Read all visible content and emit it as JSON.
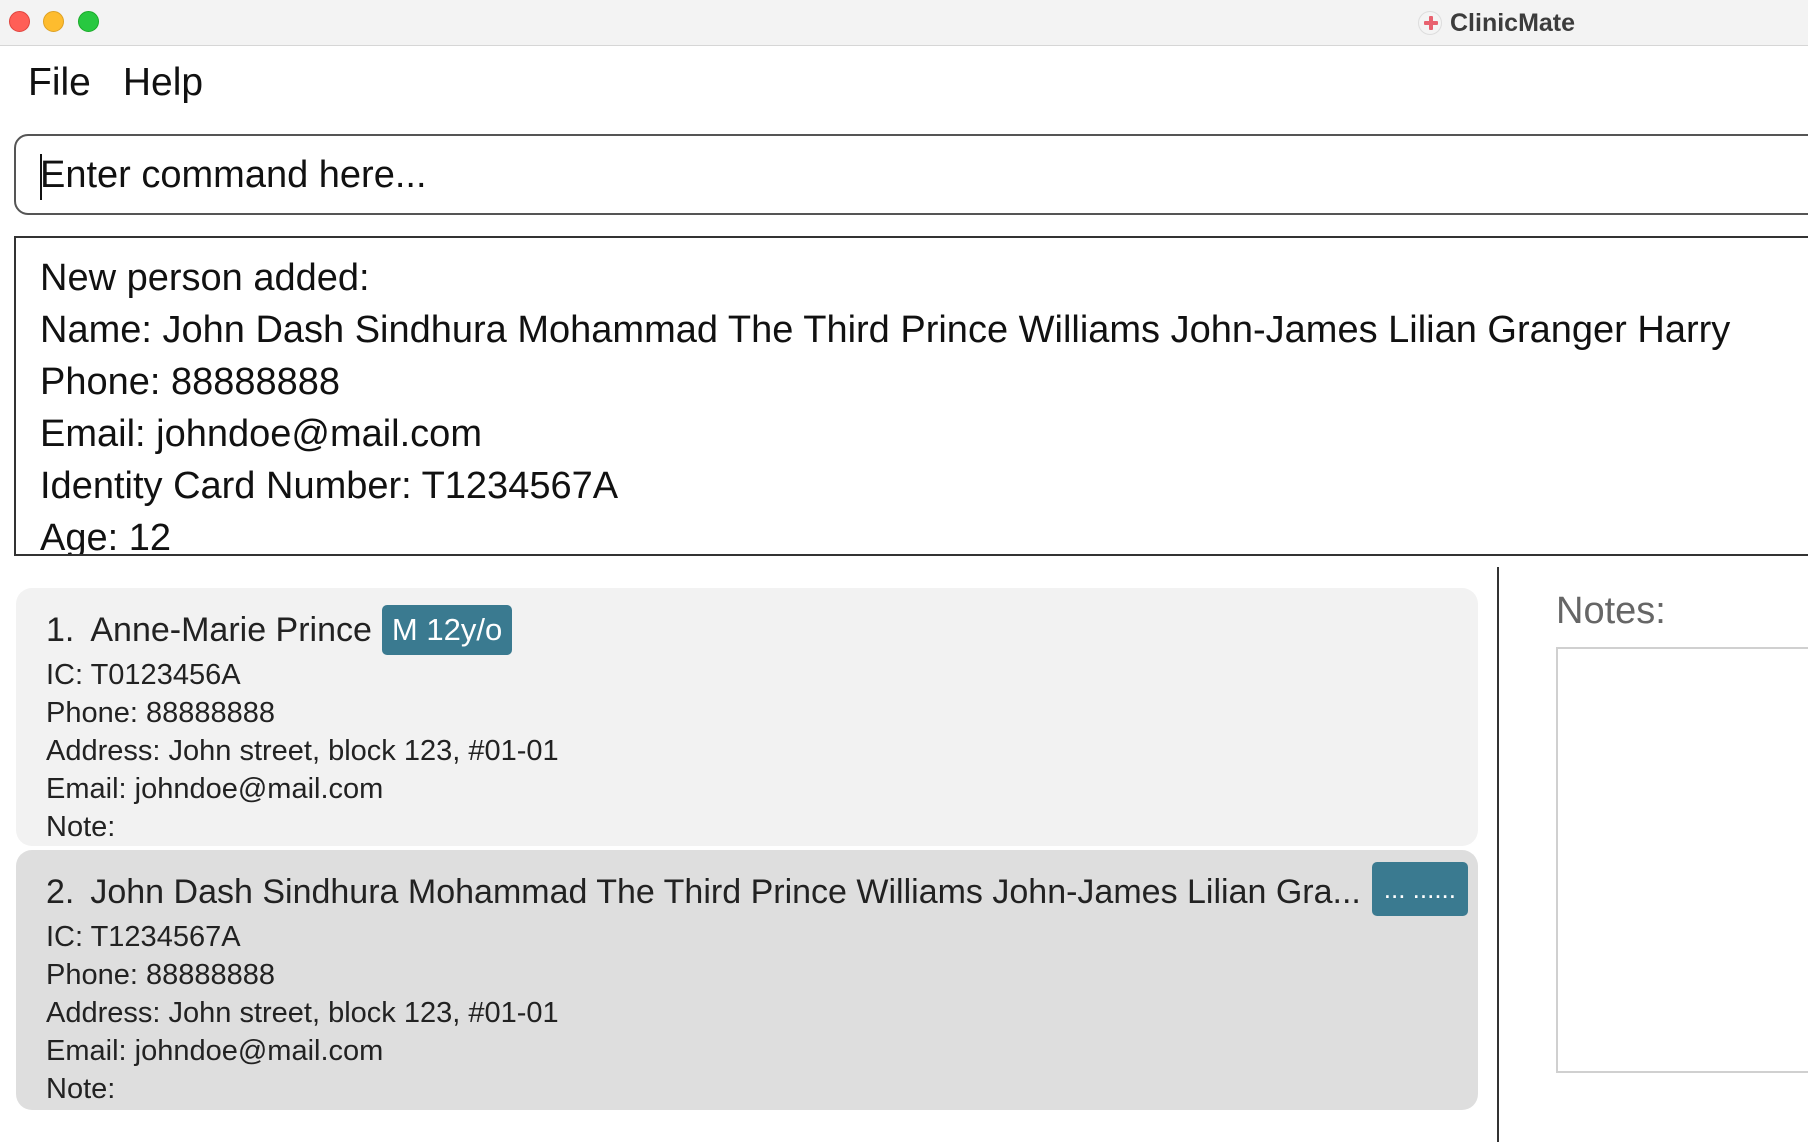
{
  "window": {
    "title": "ClinicMate",
    "icon": "red-cross-icon"
  },
  "menu": {
    "file": "File",
    "help": "Help"
  },
  "command": {
    "placeholder": "Enter command here..."
  },
  "result": {
    "lines": [
      "New person added:",
      "Name: John Dash Sindhura Mohammad The Third Prince Williams John-James Lilian Granger Harry",
      "Phone: 88888888",
      "Email: johndoe@mail.com",
      "Identity Card Number: T1234567A",
      "Age: 12"
    ]
  },
  "persons": [
    {
      "index": "1.",
      "name": "Anne-Marie Prince",
      "tag": "M 12y/o",
      "ic": "IC: T0123456A",
      "phone": "Phone: 88888888",
      "address": "Address: John street, block 123, #01-01",
      "email": "Email: johndoe@mail.com",
      "note": "Note:"
    },
    {
      "index": "2.",
      "name": "John Dash Sindhura Mohammad The Third Prince Williams John-James Lilian Gra...",
      "tag": "... ......",
      "ic": "IC: T1234567A",
      "phone": "Phone: 88888888",
      "address": "Address: John street, block 123, #01-01",
      "email": "Email: johndoe@mail.com",
      "note": "Note:"
    }
  ],
  "notes": {
    "label": "Notes:"
  },
  "colors": {
    "tag_bg": "#3a7a90",
    "card1_bg": "#f2f2f2",
    "card2_bg": "#dedede"
  }
}
